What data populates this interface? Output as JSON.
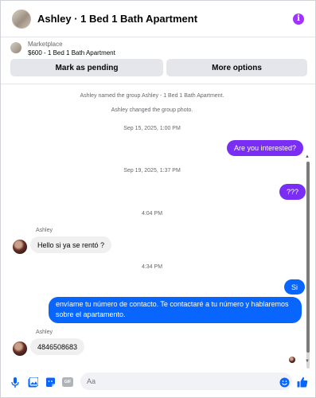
{
  "header": {
    "title": "Ashley · 1 Bed 1 Bath Apartment",
    "info_glyph": "i",
    "accent": "#a033ff"
  },
  "marketplace": {
    "label": "Marketplace",
    "item": "$600 - 1 Bed 1 Bath Apartment",
    "buttons": {
      "pending": "Mark as pending",
      "more": "More options"
    }
  },
  "chat": {
    "system": [
      "Ashley named the group Ashley - 1 Bed 1 Bath Apartment.",
      "Ashley changed the group photo."
    ],
    "timestamps": [
      "Sep 15, 2025, 1:00 PM",
      "Sep 19, 2025, 1:37 PM",
      "4:04 PM",
      "4:34 PM"
    ],
    "messages": {
      "m1": "Are you interested?",
      "m2": "???",
      "m3": "Hello si ya se rentó ?",
      "m4": "Si",
      "m5_line1": "envíame tu número de contacto. Te contactaré a tu número y hablaremos",
      "m5_line2": "sobre el apartamento.",
      "m6": "4846508683"
    },
    "sender_name": "Ashley",
    "colors": {
      "outgoing_purple": "#7a2ef5",
      "outgoing_blue": "#0866ff",
      "incoming": "#f0f0f0"
    }
  },
  "composer": {
    "placeholder": "Aa",
    "icons": [
      "microphone-icon",
      "image-icon",
      "sticker-icon",
      "gif-icon",
      "emoji-icon",
      "like-icon"
    ],
    "gif_label": "GIF"
  }
}
